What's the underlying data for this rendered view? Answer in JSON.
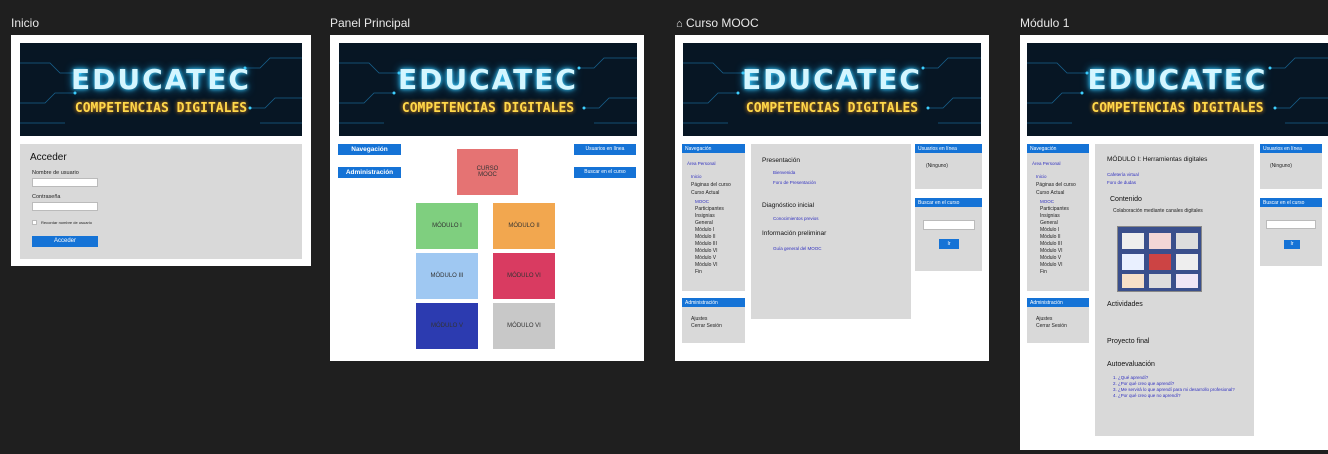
{
  "banner": {
    "title": "EDUCATEC",
    "subtitle": "COMPETENCIAS DIGITALES"
  },
  "frames": {
    "inicio": {
      "title": "Inicio",
      "heading": "Acceder",
      "username_label": "Nombre de usuario",
      "password_label": "Contraseña",
      "remember_label": "Recordar nombre de usuario",
      "login_button": "Acceder"
    },
    "panel": {
      "title": "Panel Principal",
      "nav_button": "Navegación",
      "admin_button": "Administración",
      "users_online": "Usuarios en línea",
      "search_course": "Buscar en el curso",
      "course_tile": "CURSO\nMOOC",
      "modules": [
        "MÓDULO I",
        "MÓDULO II",
        "MÓDULO III",
        "MÓDULO VI",
        "MÓDULO V",
        "MÓDULO VI"
      ],
      "colors": {
        "course": "#e57373",
        "m1": "#7fcf7f",
        "m2": "#f2a74f",
        "m3": "#9fc8f2",
        "m4": "#d93b61",
        "m5": "#2c3bb0",
        "m6": "#c8c8c8"
      }
    },
    "curso": {
      "title": "Curso MOOC",
      "nav_header": "Navegación",
      "nav_items": [
        "Área Personal",
        "Inicio",
        "Páginas del curso",
        "Curso Actual",
        "MOOC",
        "Participantes",
        "Insignias",
        "General",
        "Módulo I",
        "Módulo II",
        "Módulo III",
        "Módulo VI",
        "Módulo V",
        "Módulo VI",
        "Fin"
      ],
      "admin_header": "Administración",
      "admin_items": [
        "Ajustes",
        "Cerrar Sesión"
      ],
      "sec1_title": "Presentación",
      "sec1_links": [
        "Bienvenida",
        "Foro de Presentación"
      ],
      "sec2_title": "Diagnóstico inicial",
      "sec2_links": [
        "Conocimientos previos"
      ],
      "sec3_title": "Información preliminar",
      "sec3_links": [
        "Guía general del MOOC"
      ],
      "users_online": "Usuarios en línea",
      "users_none": "(Ninguno)",
      "search_course": "Buscar en el curso",
      "go_button": "Ir"
    },
    "modulo": {
      "title": "Módulo 1",
      "nav_header": "Navegación",
      "nav_items": [
        "Área Personal",
        "Inicio",
        "Páginas del curso",
        "Curso Actual",
        "MOOC",
        "Participantes",
        "Insignias",
        "General",
        "Módulo I",
        "Módulo II",
        "Módulo III",
        "Módulo VI",
        "Módulo V",
        "Módulo VI",
        "Fin"
      ],
      "admin_header": "Administración",
      "admin_items": [
        "Ajustes",
        "Cerrar Sesión"
      ],
      "module_title": "MÓDULO I: Herramientas digitales",
      "module_links": [
        "Cafetería virtual",
        "Foro de dudas"
      ],
      "content_title": "Contenido",
      "content_subtitle": "Colaboración mediante canales digitales",
      "activities_title": "Actividades",
      "final_title": "Proyecto final",
      "self_eval_title": "Autoevaluación",
      "self_eval_items": [
        "1. ¿Qué aprendí?",
        "2. ¿Por qué creo que aprendí?",
        "3. ¿Me servirá lo que aprendí para mi desarrollo profesional?",
        "4. ¿Por qué creo que no aprendí?"
      ],
      "users_online": "Usuarios en línea",
      "users_none": "(Ninguno)",
      "search_course": "Buscar en el curso",
      "go_button": "Ir"
    }
  }
}
